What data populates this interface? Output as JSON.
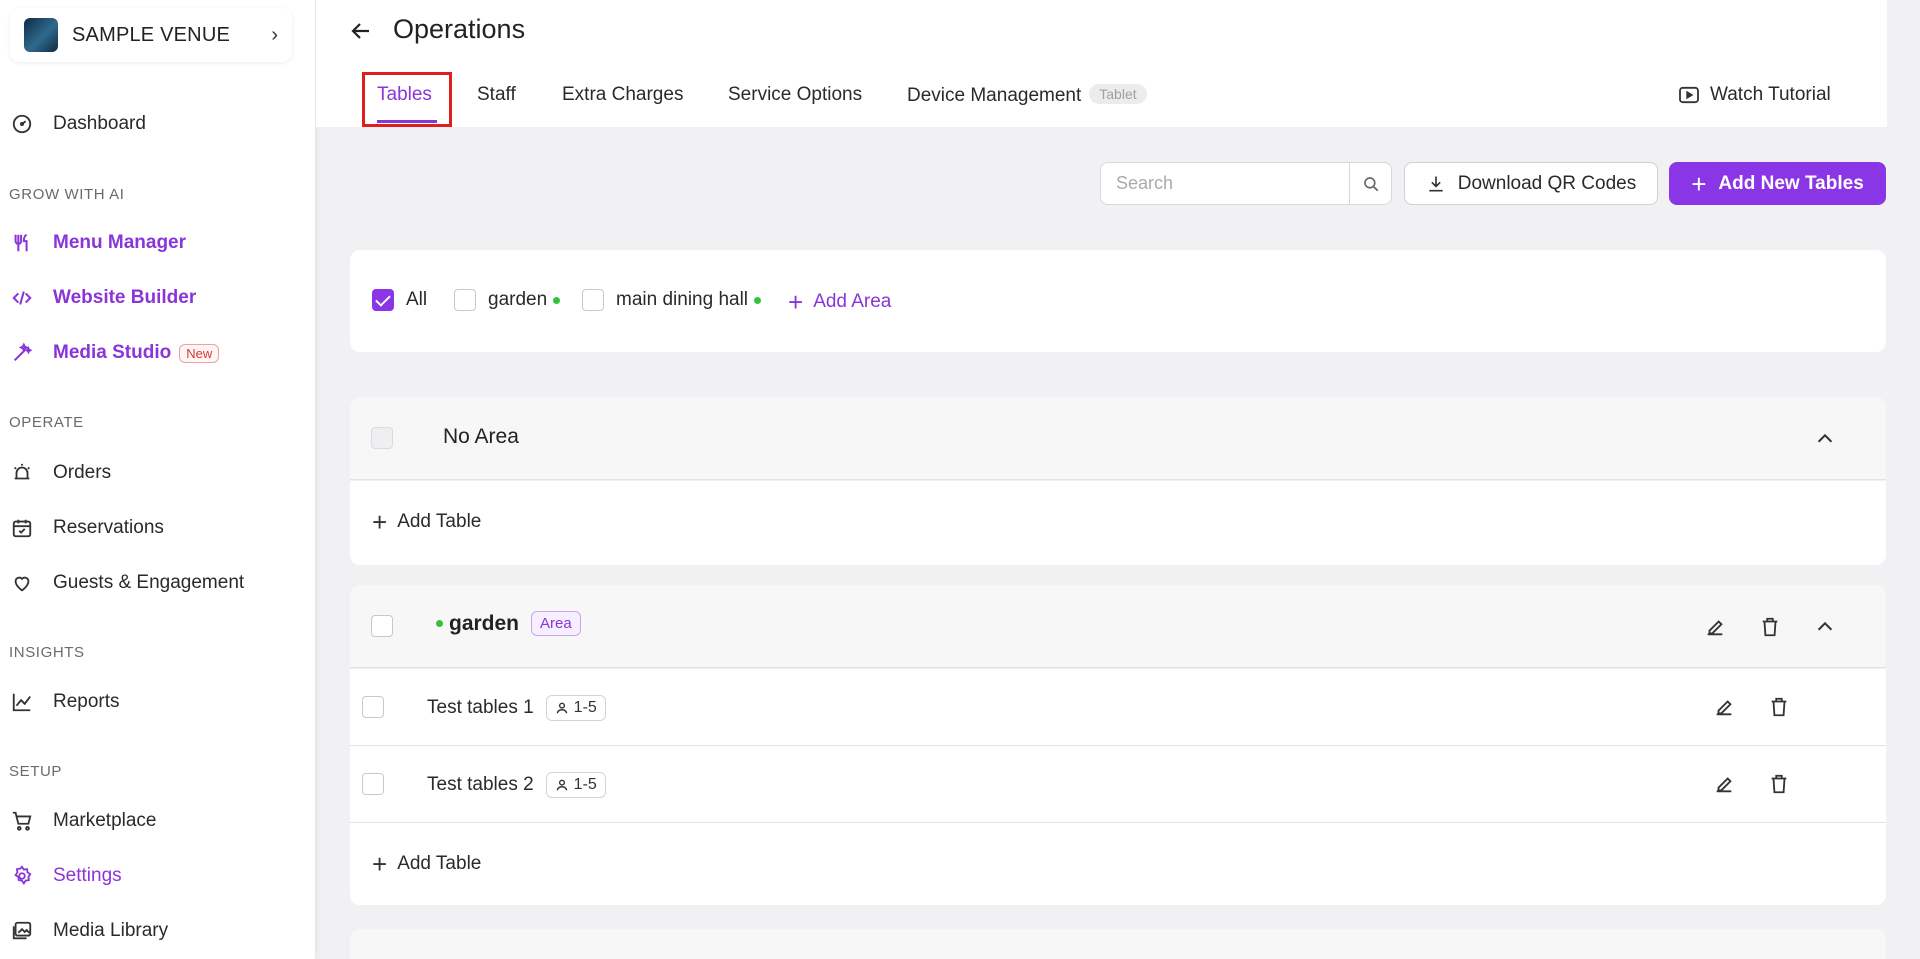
{
  "sidebar": {
    "venue_name": "SAMPLE VENUE",
    "items": {
      "dashboard": "Dashboard",
      "menu_manager": "Menu Manager",
      "website_builder": "Website Builder",
      "media_studio": "Media Studio",
      "media_studio_badge": "New",
      "orders": "Orders",
      "reservations": "Reservations",
      "guests": "Guests & Engagement",
      "reports": "Reports",
      "marketplace": "Marketplace",
      "settings": "Settings",
      "media_library": "Media Library"
    },
    "sections": {
      "grow": "GROW WITH AI",
      "operate": "OPERATE",
      "insights": "INSIGHTS",
      "setup": "SETUP"
    }
  },
  "header": {
    "title": "Operations",
    "tabs": {
      "tables": "Tables",
      "staff": "Staff",
      "extra_charges": "Extra Charges",
      "service_options": "Service Options",
      "device_management": "Device Management",
      "device_badge": "Tablet"
    },
    "watch_tutorial": "Watch Tutorial"
  },
  "toolbar": {
    "search_placeholder": "Search",
    "download_qr": "Download QR Codes",
    "add_new_tables": "Add New Tables"
  },
  "filters": {
    "all": "All",
    "garden": "garden",
    "main_dining_hall": "main dining hall",
    "add_area": "Add Area"
  },
  "groups": {
    "no_area": {
      "title": "No Area",
      "add_table": "Add Table"
    },
    "garden": {
      "title": "garden",
      "badge": "Area",
      "tables": [
        {
          "name": "Test tables 1",
          "capacity": "1-5"
        },
        {
          "name": "Test tables 2",
          "capacity": "1-5"
        }
      ],
      "add_table": "Add Table"
    }
  },
  "colors": {
    "accent": "#8a35e6",
    "area_dot": "#35c23a",
    "highlight_box": "#e01e1e"
  }
}
